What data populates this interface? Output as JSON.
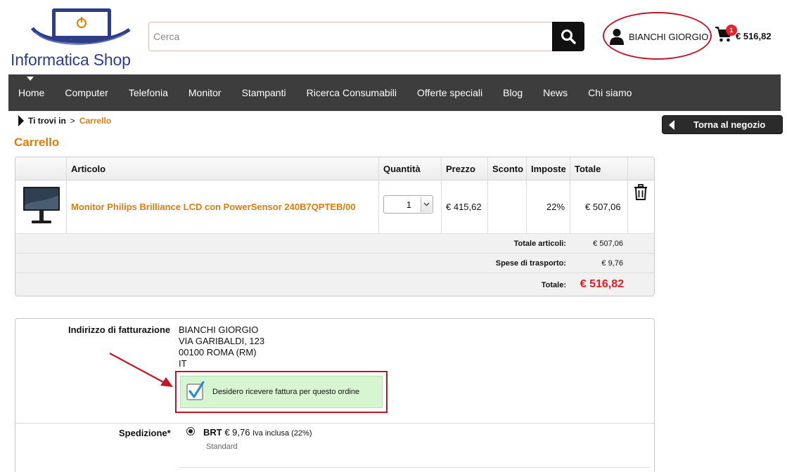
{
  "header": {
    "logo_text": "Informatica Shop",
    "search_placeholder": "Cerca",
    "user_name": "BIANCHI GIORGIO",
    "cart_count": "1",
    "cart_total": "€ 516,82"
  },
  "nav": {
    "items": [
      "Home",
      "Computer",
      "Telefonia",
      "Monitor",
      "Stampanti",
      "Ricerca Consumabili",
      "Offerte speciali",
      "Blog",
      "News",
      "Chi siamo"
    ]
  },
  "breadcrumb": {
    "label": "Ti trovi in",
    "separator": ">",
    "current": "Carrello"
  },
  "back_button": "Torna al negozio",
  "page_title": "Carrello",
  "cart": {
    "headers": {
      "article": "Articolo",
      "quantity": "Quantità",
      "price": "Prezzo",
      "discount": "Sconto",
      "taxes": "Imposte",
      "total": "Totale"
    },
    "item": {
      "name": "Monitor Philips Brilliance LCD con PowerSensor 240B7QPTEB/00",
      "quantity": "1",
      "price": "€ 415,62",
      "discount": "",
      "tax": "22%",
      "total": "€ 507,06"
    },
    "summary": {
      "articles_label": "Totale articoli:",
      "articles_value": "€ 507,06",
      "shipping_label": "Spese di trasporto:",
      "shipping_value": "€ 9,76",
      "total_label": "Totale:",
      "total_value": "€ 516,82"
    }
  },
  "billing": {
    "label": "Indirizzo di fatturazione",
    "address": [
      "BIANCHI GIORGIO",
      "VIA GARIBALDI, 123",
      "00100 ROMA (RM)",
      "IT"
    ],
    "invoice_checkbox_label": "Desidero ricevere fattura per questo ordine",
    "invoice_checked": true
  },
  "shipping": {
    "label": "Spedizione*",
    "carrier": "BRT",
    "price": "€ 9,76",
    "vat_note": "Iva inclusa (22%)",
    "service": "Standard"
  },
  "colors": {
    "accent_orange": "#e07b0c",
    "total_red": "#e01b22",
    "highlight_red": "#c0162a",
    "nav_bg": "#3d3d3d",
    "logo_blue": "#2e3e86",
    "invoice_green": "#d8f5d2"
  }
}
